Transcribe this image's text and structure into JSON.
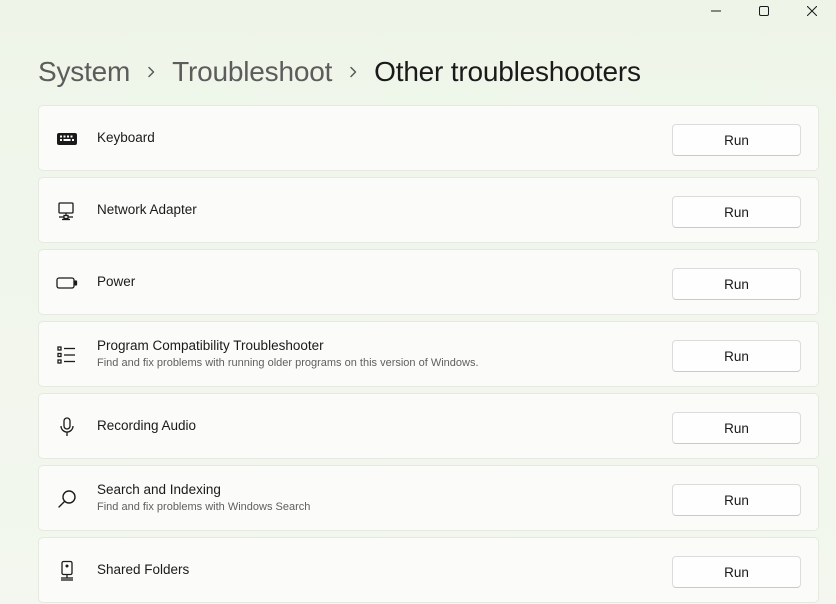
{
  "breadcrumb": {
    "items": [
      "System",
      "Troubleshoot"
    ],
    "current": "Other troubleshooters"
  },
  "run_label": "Run",
  "items": [
    {
      "title": "Keyboard",
      "desc": "",
      "icon": "keyboard-icon"
    },
    {
      "title": "Network Adapter",
      "desc": "",
      "icon": "network-adapter-icon"
    },
    {
      "title": "Power",
      "desc": "",
      "icon": "battery-icon"
    },
    {
      "title": "Program Compatibility Troubleshooter",
      "desc": "Find and fix problems with running older programs on this version of Windows.",
      "icon": "list-icon"
    },
    {
      "title": "Recording Audio",
      "desc": "",
      "icon": "microphone-icon"
    },
    {
      "title": "Search and Indexing",
      "desc": "Find and fix problems with Windows Search",
      "icon": "search-icon"
    },
    {
      "title": "Shared Folders",
      "desc": "",
      "icon": "shared-folder-icon"
    }
  ]
}
